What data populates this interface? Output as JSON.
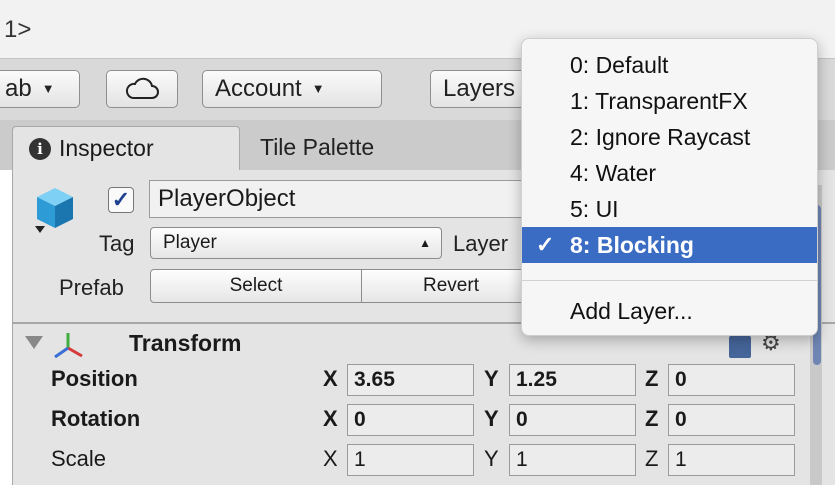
{
  "title_strip": {
    "crumb": "1>"
  },
  "toolbar": {
    "prefab_label": "ab",
    "account_label": "Account",
    "layers_label": "Layers"
  },
  "tabs": [
    {
      "label": "Inspector",
      "active": true
    },
    {
      "label": "Tile Palette",
      "active": false
    }
  ],
  "gameobject": {
    "active": true,
    "name": "PlayerObject",
    "tag_label": "Tag",
    "tag_value": "Player",
    "layer_label": "Layer",
    "prefab_label": "Prefab",
    "prefab_select": "Select",
    "prefab_revert": "Revert"
  },
  "transform": {
    "title": "Transform",
    "rows": [
      {
        "label": "Position",
        "x": "3.65",
        "y": "1.25",
        "z": "0"
      },
      {
        "label": "Rotation",
        "x": "0",
        "y": "0",
        "z": "0"
      },
      {
        "label": "Scale",
        "x": "1",
        "y": "1",
        "z": "1"
      }
    ],
    "axes": {
      "x": "X",
      "y": "Y",
      "z": "Z"
    }
  },
  "layer_menu": {
    "items": [
      {
        "label": "0: Default",
        "selected": false
      },
      {
        "label": "1: TransparentFX",
        "selected": false
      },
      {
        "label": "2: Ignore Raycast",
        "selected": false
      },
      {
        "label": "4: Water",
        "selected": false
      },
      {
        "label": "5: UI",
        "selected": false
      },
      {
        "label": "8: Blocking",
        "selected": true
      }
    ],
    "add_label": "Add Layer...",
    "check_glyph": "✓"
  },
  "colors": {
    "selection": "#3b6cc4",
    "panel": "#e4e4e4",
    "toolbar": "#d9d9d9"
  }
}
